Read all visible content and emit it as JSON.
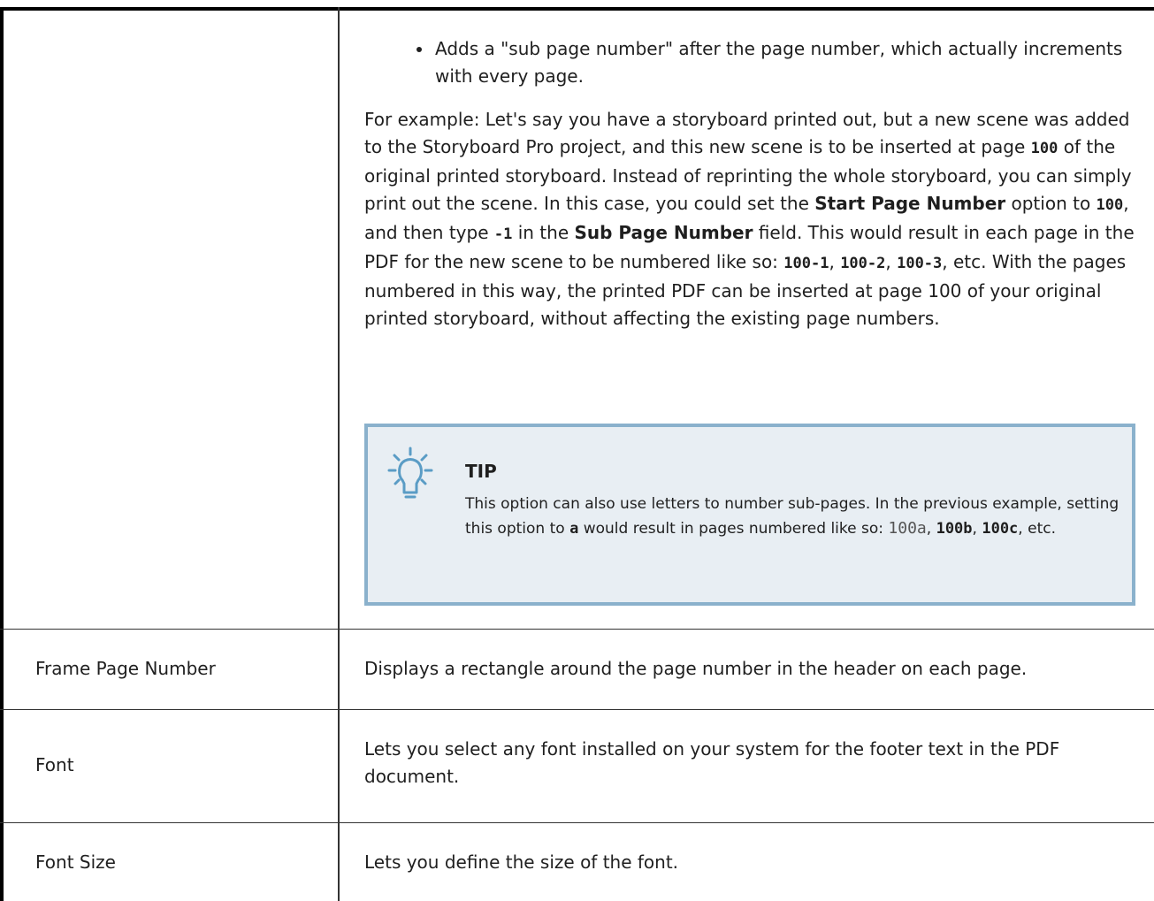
{
  "row1": {
    "bullet": "Adds a \"sub page number\" after the page number, which actually increments with every page.",
    "example": {
      "p1": "For example: Let's say you have a storyboard printed out, but a new scene was added to the Storyboard Pro project, and this new scene is to be inserted at page ",
      "code1": "100",
      "p2": " of the original printed storyboard. Instead of reprinting the whole storyboard, you can simply print out the scene. In this case, you could set the ",
      "bold1": "Start Page Number",
      "p3": " option to ",
      "code2": "100",
      "p4": ", and then type ",
      "code3": "-1",
      "p5": " in the ",
      "bold2": "Sub Page Number",
      "p6": " field. This would result in each page in the PDF for the new scene to be numbered like so: ",
      "code4": "100-1",
      "sep1": ", ",
      "code5": "100-2",
      "sep2": ", ",
      "code6": "100-3",
      "p7": ", etc. With the pages numbered in this way, the printed PDF can be inserted at page 100 of your original printed storyboard, without affecting the existing page numbers."
    },
    "tip": {
      "icon": "lightbulb-icon",
      "title": "TIP",
      "t1": "This option can also use letters to number sub-pages. In the previous example, setting this option to ",
      "code_a": "a",
      "t2": " would result in pages numbered like so: ",
      "code_plain": "100a",
      "sep1": ", ",
      "code_b": "100b",
      "sep2": ", ",
      "code_c": "100c",
      "t3": ", etc."
    }
  },
  "rows": [
    {
      "label": "Frame Page Number",
      "desc": "Displays a rectangle around the page number in the header on each page."
    },
    {
      "label": "Font",
      "desc": "Lets you select any font installed on your system for the footer text in the PDF document."
    },
    {
      "label": "Font Size",
      "desc": "Lets you define the size of the font."
    }
  ],
  "colors": {
    "tip_bg": "#e8eef3",
    "tip_border": "#8ab1cc",
    "icon": "#5a9cc5"
  }
}
